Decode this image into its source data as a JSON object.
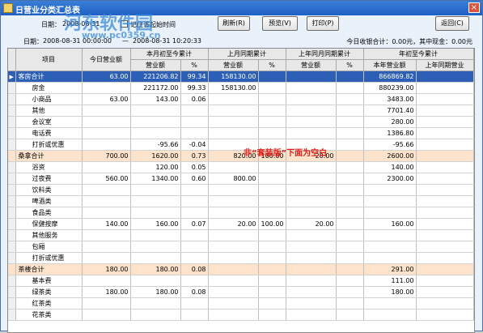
{
  "window": {
    "title": "日营业分类汇总表"
  },
  "toolbar": {
    "date_label": "日期：",
    "date_value": "2008-08-31",
    "remember_label": "记住该起始时间",
    "buttons": {
      "refresh": "刷新(R)",
      "preview": "预览(V)",
      "print": "打印(P)",
      "back": "返回(C)"
    }
  },
  "date_range": {
    "label": "日期：",
    "start": "2008-08-31 00:00:00",
    "sep": "—",
    "end": "2008-08-31 10:20:33"
  },
  "summary": {
    "text": "今日收银合计：0.00元，其中现金：0.00元"
  },
  "watermark": {
    "main": "河东软件园",
    "sub": "www.pc0359.cn"
  },
  "note": "非“套装版”下面为空白",
  "table": {
    "group_headers": {
      "item": "项目",
      "today": "今日营业额",
      "month": "本月初至今累计",
      "last_month": "上月同期累计",
      "last_year_month": "上年同月同期累计",
      "year": "年初至今累计"
    },
    "sub_headers": {
      "revenue": "营业额",
      "pct": "%",
      "this_year": "本年营业额",
      "last_year_same": "上年同期营业"
    },
    "rows": [
      {
        "type": "sel",
        "name": "客房合计",
        "today": "63.00",
        "m_rev": "221206.82",
        "m_pct": "99.34",
        "lm_rev": "158130.00",
        "lm_pct": "",
        "ly_rev": "",
        "ly_pct": "",
        "y_rev": "866869.82",
        "y_last": ""
      },
      {
        "type": "sub",
        "name": "房金",
        "today": "",
        "m_rev": "221172.00",
        "m_pct": "99.33",
        "lm_rev": "158130.00",
        "lm_pct": "",
        "ly_rev": "",
        "ly_pct": "",
        "y_rev": "880239.00",
        "y_last": ""
      },
      {
        "type": "sub",
        "name": "小商品",
        "today": "63.00",
        "m_rev": "143.00",
        "m_pct": "0.06",
        "lm_rev": "",
        "lm_pct": "",
        "ly_rev": "",
        "ly_pct": "",
        "y_rev": "3483.00",
        "y_last": ""
      },
      {
        "type": "sub",
        "name": "其他",
        "today": "",
        "m_rev": "",
        "m_pct": "",
        "lm_rev": "",
        "lm_pct": "",
        "ly_rev": "",
        "ly_pct": "",
        "y_rev": "7701.40",
        "y_last": ""
      },
      {
        "type": "sub",
        "name": "会议室",
        "today": "",
        "m_rev": "",
        "m_pct": "",
        "lm_rev": "",
        "lm_pct": "",
        "ly_rev": "",
        "ly_pct": "",
        "y_rev": "280.00",
        "y_last": ""
      },
      {
        "type": "sub",
        "name": "电话费",
        "today": "",
        "m_rev": "",
        "m_pct": "",
        "lm_rev": "",
        "lm_pct": "",
        "ly_rev": "",
        "ly_pct": "",
        "y_rev": "1386.80",
        "y_last": ""
      },
      {
        "type": "sub",
        "name": "打折或优惠",
        "today": "",
        "m_rev": "-95.66",
        "m_pct": "-0.04",
        "lm_rev": "",
        "lm_pct": "",
        "ly_rev": "",
        "ly_pct": "",
        "y_rev": "-95.66",
        "y_last": ""
      },
      {
        "type": "cat",
        "name": "桑拿合计",
        "today": "700.00",
        "m_rev": "1620.00",
        "m_pct": "0.73",
        "lm_rev": "820.00",
        "lm_pct": "100.00",
        "ly_rev": "20.00",
        "ly_pct": "",
        "y_rev": "2600.00",
        "y_last": ""
      },
      {
        "type": "sub",
        "name": "浴资",
        "today": "",
        "m_rev": "120.00",
        "m_pct": "0.05",
        "lm_rev": "",
        "lm_pct": "",
        "ly_rev": "",
        "ly_pct": "",
        "y_rev": "140.00",
        "y_last": ""
      },
      {
        "type": "sub",
        "name": "过夜费",
        "today": "560.00",
        "m_rev": "1340.00",
        "m_pct": "0.60",
        "lm_rev": "800.00",
        "lm_pct": "",
        "ly_rev": "",
        "ly_pct": "",
        "y_rev": "2300.00",
        "y_last": ""
      },
      {
        "type": "sub",
        "name": "饮料类",
        "today": "",
        "m_rev": "",
        "m_pct": "",
        "lm_rev": "",
        "lm_pct": "",
        "ly_rev": "",
        "ly_pct": "",
        "y_rev": "",
        "y_last": ""
      },
      {
        "type": "sub",
        "name": "啤酒类",
        "today": "",
        "m_rev": "",
        "m_pct": "",
        "lm_rev": "",
        "lm_pct": "",
        "ly_rev": "",
        "ly_pct": "",
        "y_rev": "",
        "y_last": ""
      },
      {
        "type": "sub",
        "name": "食品类",
        "today": "",
        "m_rev": "",
        "m_pct": "",
        "lm_rev": "",
        "lm_pct": "",
        "ly_rev": "",
        "ly_pct": "",
        "y_rev": "",
        "y_last": ""
      },
      {
        "type": "sub",
        "name": "保健按摩",
        "today": "140.00",
        "m_rev": "160.00",
        "m_pct": "0.07",
        "lm_rev": "20.00",
        "lm_pct": "100.00",
        "ly_rev": "20.00",
        "ly_pct": "",
        "y_rev": "160.00",
        "y_last": ""
      },
      {
        "type": "sub",
        "name": "其他服务",
        "today": "",
        "m_rev": "",
        "m_pct": "",
        "lm_rev": "",
        "lm_pct": "",
        "ly_rev": "",
        "ly_pct": "",
        "y_rev": "",
        "y_last": ""
      },
      {
        "type": "sub",
        "name": "包厢",
        "today": "",
        "m_rev": "",
        "m_pct": "",
        "lm_rev": "",
        "lm_pct": "",
        "ly_rev": "",
        "ly_pct": "",
        "y_rev": "",
        "y_last": ""
      },
      {
        "type": "sub",
        "name": "打折或优惠",
        "today": "",
        "m_rev": "",
        "m_pct": "",
        "lm_rev": "",
        "lm_pct": "",
        "ly_rev": "",
        "ly_pct": "",
        "y_rev": "",
        "y_last": ""
      },
      {
        "type": "cat",
        "name": "茶楼合计",
        "today": "180.00",
        "m_rev": "180.00",
        "m_pct": "0.08",
        "lm_rev": "",
        "lm_pct": "",
        "ly_rev": "",
        "ly_pct": "",
        "y_rev": "291.00",
        "y_last": ""
      },
      {
        "type": "sub",
        "name": "基本费",
        "today": "",
        "m_rev": "",
        "m_pct": "",
        "lm_rev": "",
        "lm_pct": "",
        "ly_rev": "",
        "ly_pct": "",
        "y_rev": "111.00",
        "y_last": ""
      },
      {
        "type": "sub",
        "name": "绿茶类",
        "today": "180.00",
        "m_rev": "180.00",
        "m_pct": "0.08",
        "lm_rev": "",
        "lm_pct": "",
        "ly_rev": "",
        "ly_pct": "",
        "y_rev": "180.00",
        "y_last": ""
      },
      {
        "type": "sub",
        "name": "红茶类",
        "today": "",
        "m_rev": "",
        "m_pct": "",
        "lm_rev": "",
        "lm_pct": "",
        "ly_rev": "",
        "ly_pct": "",
        "y_rev": "",
        "y_last": ""
      },
      {
        "type": "sub",
        "name": "花茶类",
        "today": "",
        "m_rev": "",
        "m_pct": "",
        "lm_rev": "",
        "lm_pct": "",
        "ly_rev": "",
        "ly_pct": "",
        "y_rev": "",
        "y_last": ""
      }
    ]
  }
}
